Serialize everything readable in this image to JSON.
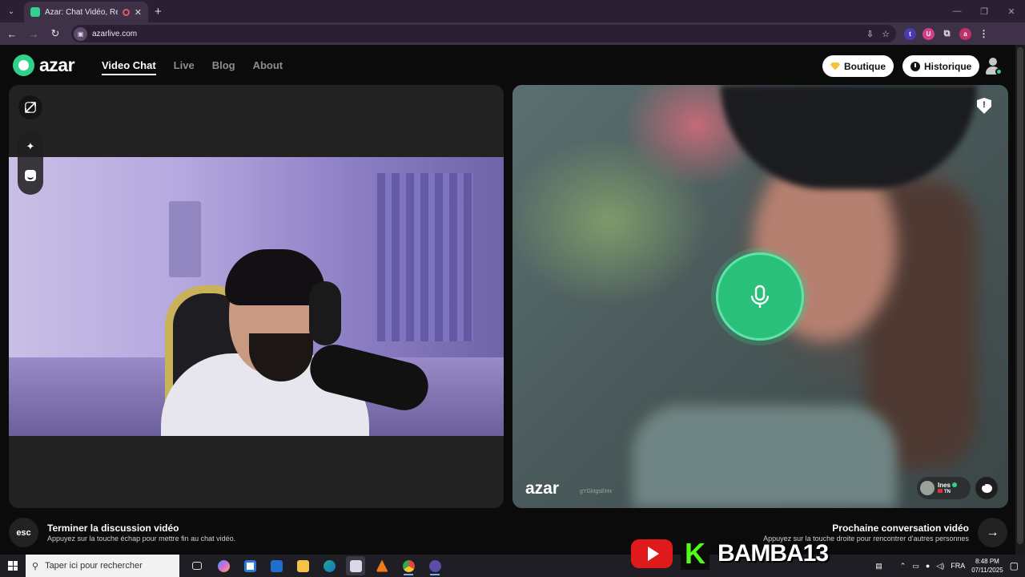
{
  "browser": {
    "tab_title": "Azar: Chat Vidéo, Rencontr",
    "url": "azarlive.com",
    "new_tab": "+",
    "close_tab": "✕",
    "extensions": [
      "t",
      "U",
      "a"
    ]
  },
  "header": {
    "logo": "azar",
    "nav": [
      "Video Chat",
      "Live",
      "Blog",
      "About"
    ],
    "active_nav": "Video Chat",
    "boutique": "Boutique",
    "historique": "Historique"
  },
  "remote": {
    "watermark": "azar",
    "session_id": "gYGktgsEHx",
    "user_name": "Ines",
    "country": "TN"
  },
  "bottom": {
    "esc_key": "esc",
    "end_title": "Terminer la discussion vidéo",
    "end_sub": "Appuyez sur la touche échap pour mettre fin au chat vidéo.",
    "next_title": "Prochaine conversation vidéo",
    "next_sub": "Appuyez sur la touche droite pour rencontrer d'autres personnes",
    "next_key": "→"
  },
  "taskbar": {
    "search_placeholder": "Taper ici pour rechercher",
    "language": "FRA",
    "time": "8:48 PM",
    "date": "07/11/2025"
  },
  "overlay": {
    "streamer": "BAMBA13",
    "kick_letter": "K"
  },
  "colors": {
    "accent": "#2fd18b",
    "page_bg": "#0b0b0b",
    "panel_bg": "#222222",
    "chrome_bg": "#3f3248"
  }
}
